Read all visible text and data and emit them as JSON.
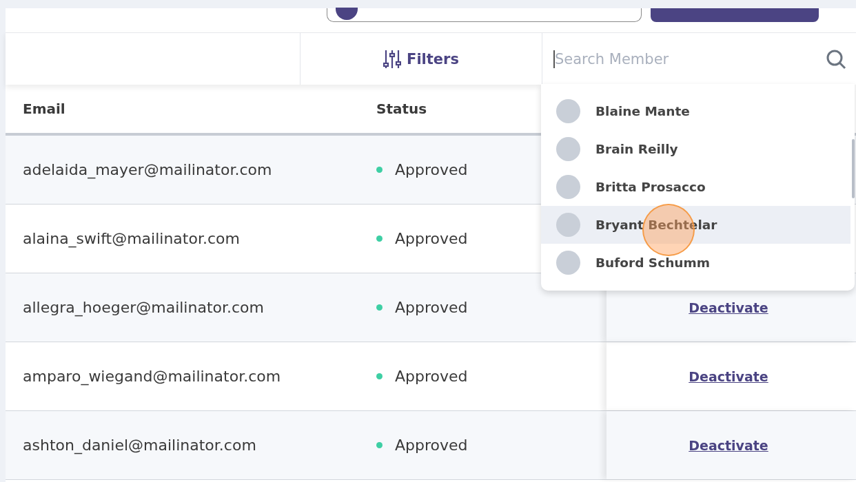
{
  "filters_button": {
    "label": "Filters"
  },
  "search": {
    "placeholder": "Search Member"
  },
  "table": {
    "columns": [
      "Email",
      "Status"
    ],
    "rows": [
      {
        "email": "adelaida_mayer@mailinator.com",
        "status": "Approved"
      },
      {
        "email": "alaina_swift@mailinator.com",
        "status": "Approved"
      },
      {
        "email": "allegra_hoeger@mailinator.com",
        "status": "Approved",
        "action": "Deactivate"
      },
      {
        "email": "amparo_wiegand@mailinator.com",
        "status": "Approved",
        "action": "Deactivate"
      },
      {
        "email": "ashton_daniel@mailinator.com",
        "status": "Approved",
        "action": "Deactivate"
      }
    ]
  },
  "member_dropdown": {
    "items": [
      {
        "name": "Blaine Mante",
        "selected": false
      },
      {
        "name": "Brain Reilly",
        "selected": false
      },
      {
        "name": "Britta Prosacco",
        "selected": false
      },
      {
        "name": "Bryant Bechtelar",
        "selected": true
      },
      {
        "name": "Buford Schumm",
        "selected": false
      }
    ]
  }
}
